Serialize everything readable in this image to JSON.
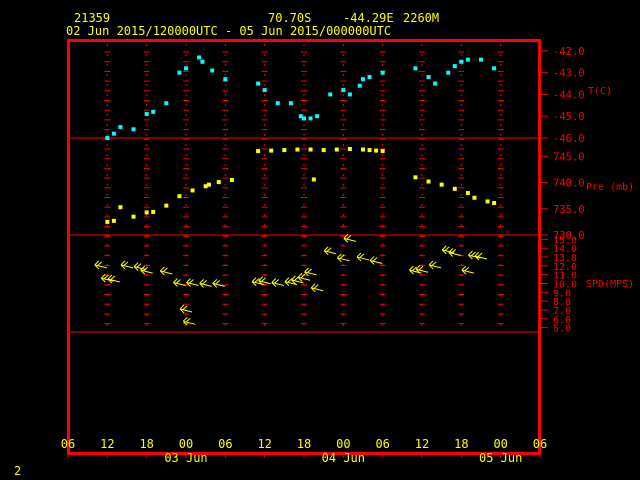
{
  "header": {
    "station": "21359",
    "lat": "70.70S",
    "lon": "-44.29E",
    "elev": "2260M",
    "period": "02 Jun 2015/120000UTC - 05 Jun 2015/000000UTC"
  },
  "page_number": "2",
  "colors": {
    "frame": "#ff0000",
    "ticks": "#ff0000",
    "text": "#ffff00",
    "temp": "#00ffff",
    "pres": "#ffff00",
    "wind": "#ffff00"
  },
  "chart_data": {
    "type": "scatter",
    "x_axis": {
      "start": "2015-06-02 06UTC",
      "end": "2015-06-05 06UTC",
      "unit": "hours",
      "tick_labels": [
        "06",
        "12",
        "18",
        "00",
        "06",
        "12",
        "18",
        "00",
        "06",
        "12",
        "18",
        "00",
        "06"
      ],
      "day_labels": [
        {
          "label": "03 Jun",
          "at": "2015-06-03 00UTC"
        },
        {
          "label": "04 Jun",
          "at": "2015-06-04 00UTC"
        },
        {
          "label": "05 Jun",
          "at": "2015-06-05 00UTC"
        }
      ]
    },
    "panels": [
      {
        "name": "temperature",
        "ylabel": "T(C)",
        "ylim": [
          -46,
          -41.5
        ],
        "yticks": [
          -42,
          -43,
          -44,
          -45,
          -46
        ],
        "ytick_labels": [
          "-42.0",
          "-43.0",
          "-44.0",
          "-45.0",
          "-46.0"
        ],
        "color": "#00ffff",
        "x": [
          "2015-06-02 12:00",
          "2015-06-02 13:00",
          "2015-06-02 14:00",
          "2015-06-02 16:00",
          "2015-06-02 18:00",
          "2015-06-02 19:00",
          "2015-06-02 21:00",
          "2015-06-02 23:00",
          "2015-06-03 00:00",
          "2015-06-03 02:00",
          "2015-06-03 02:30",
          "2015-06-03 04:00",
          "2015-06-03 06:00",
          "2015-06-03 11:00",
          "2015-06-03 12:00",
          "2015-06-03 14:00",
          "2015-06-03 16:00",
          "2015-06-03 17:30",
          "2015-06-03 18:00",
          "2015-06-03 19:00",
          "2015-06-03 20:00",
          "2015-06-03 22:00",
          "2015-06-04 00:00",
          "2015-06-04 01:00",
          "2015-06-04 02:30",
          "2015-06-04 03:00",
          "2015-06-04 04:00",
          "2015-06-04 06:00",
          "2015-06-04 11:00",
          "2015-06-04 13:00",
          "2015-06-04 14:00",
          "2015-06-04 16:00",
          "2015-06-04 17:00",
          "2015-06-04 18:00",
          "2015-06-04 19:00",
          "2015-06-04 21:00",
          "2015-06-04 23:00"
        ],
        "values": [
          -46.0,
          -45.8,
          -45.5,
          -45.6,
          -44.9,
          -44.8,
          -44.4,
          -43.0,
          -42.8,
          -42.3,
          -42.5,
          -42.9,
          -43.3,
          -43.5,
          -43.8,
          -44.4,
          -44.4,
          -45.0,
          -45.1,
          -45.1,
          -45.0,
          -44.0,
          -43.8,
          -44.0,
          -43.6,
          -43.3,
          -43.2,
          -43.0,
          -42.8,
          -43.2,
          -43.5,
          -43.0,
          -42.7,
          -42.5,
          -42.4,
          -42.4,
          -42.8
        ]
      },
      {
        "name": "pressure",
        "ylabel": "Pre (mb)",
        "ylim": [
          730,
          748.5
        ],
        "yticks": [
          745,
          740,
          735,
          730
        ],
        "ytick_labels": [
          "745.0",
          "740.0",
          "735.0",
          "730.0"
        ],
        "color": "#ffff00",
        "x": [
          "2015-06-02 12:00",
          "2015-06-02 13:00",
          "2015-06-02 14:00",
          "2015-06-02 16:00",
          "2015-06-02 18:00",
          "2015-06-02 19:00",
          "2015-06-02 21:00",
          "2015-06-02 23:00",
          "2015-06-03 01:00",
          "2015-06-03 03:00",
          "2015-06-03 03:30",
          "2015-06-03 05:00",
          "2015-06-03 07:00",
          "2015-06-03 11:00",
          "2015-06-03 13:00",
          "2015-06-03 15:00",
          "2015-06-03 17:00",
          "2015-06-03 19:00",
          "2015-06-03 19:30",
          "2015-06-03 21:00",
          "2015-06-03 23:00",
          "2015-06-04 01:00",
          "2015-06-04 03:00",
          "2015-06-04 04:00",
          "2015-06-04 05:00",
          "2015-06-04 06:00",
          "2015-06-04 11:00",
          "2015-06-04 13:00",
          "2015-06-04 15:00",
          "2015-06-04 17:00",
          "2015-06-04 19:00",
          "2015-06-04 20:00",
          "2015-06-04 22:00",
          "2015-06-04 23:00"
        ],
        "values": [
          732.5,
          732.7,
          735.3,
          733.5,
          734.3,
          734.4,
          735.6,
          737.4,
          738.5,
          739.3,
          739.6,
          740.1,
          740.5,
          746.0,
          746.1,
          746.2,
          746.3,
          746.3,
          740.6,
          746.2,
          746.3,
          746.4,
          746.3,
          746.2,
          746.1,
          746.0,
          741.0,
          740.2,
          739.6,
          738.8,
          738.0,
          737.1,
          736.4,
          736.1
        ]
      },
      {
        "name": "wind",
        "ylabel": "SPD(MPS)",
        "ylim": [
          4.5,
          15.5
        ],
        "yticks": [
          15,
          14,
          13,
          12,
          11,
          10,
          9,
          8,
          7,
          6,
          5
        ],
        "ytick_labels": [
          "15.0",
          "14.0",
          "13.0",
          "12.0",
          "11.0",
          "10.0",
          "9.0",
          "8.0",
          "7.0",
          "6.0",
          "5.0"
        ],
        "color": "#ffff00",
        "x": [
          "2015-06-02 11:00",
          "2015-06-02 12:00",
          "2015-06-02 13:00",
          "2015-06-02 15:00",
          "2015-06-02 17:00",
          "2015-06-02 18:00",
          "2015-06-02 21:00",
          "2015-06-02 23:00",
          "2015-06-03 00:00",
          "2015-06-03 00:30",
          "2015-06-03 01:00",
          "2015-06-03 03:00",
          "2015-06-03 05:00",
          "2015-06-03 11:00",
          "2015-06-03 12:00",
          "2015-06-03 14:00",
          "2015-06-03 16:00",
          "2015-06-03 17:00",
          "2015-06-03 18:00",
          "2015-06-03 19:00",
          "2015-06-03 20:00",
          "2015-06-03 22:00",
          "2015-06-04 00:00",
          "2015-06-04 01:00",
          "2015-06-04 03:00",
          "2015-06-04 05:00",
          "2015-06-04 11:00",
          "2015-06-04 12:00",
          "2015-06-04 14:00",
          "2015-06-04 16:00",
          "2015-06-04 17:00",
          "2015-06-04 19:00",
          "2015-06-04 20:00",
          "2015-06-04 21:00"
        ],
        "values": [
          12.0,
          10.5,
          10.4,
          12.0,
          11.8,
          11.4,
          11.3,
          10.0,
          7.0,
          5.6,
          10.0,
          9.9,
          9.9,
          10.1,
          10.2,
          10.0,
          10.1,
          10.3,
          10.6,
          11.2,
          9.4,
          13.6,
          12.8,
          15.0,
          12.9,
          12.5,
          11.4,
          11.5,
          12.0,
          13.7,
          13.4,
          11.4,
          13.1,
          13.0
        ]
      }
    ]
  }
}
